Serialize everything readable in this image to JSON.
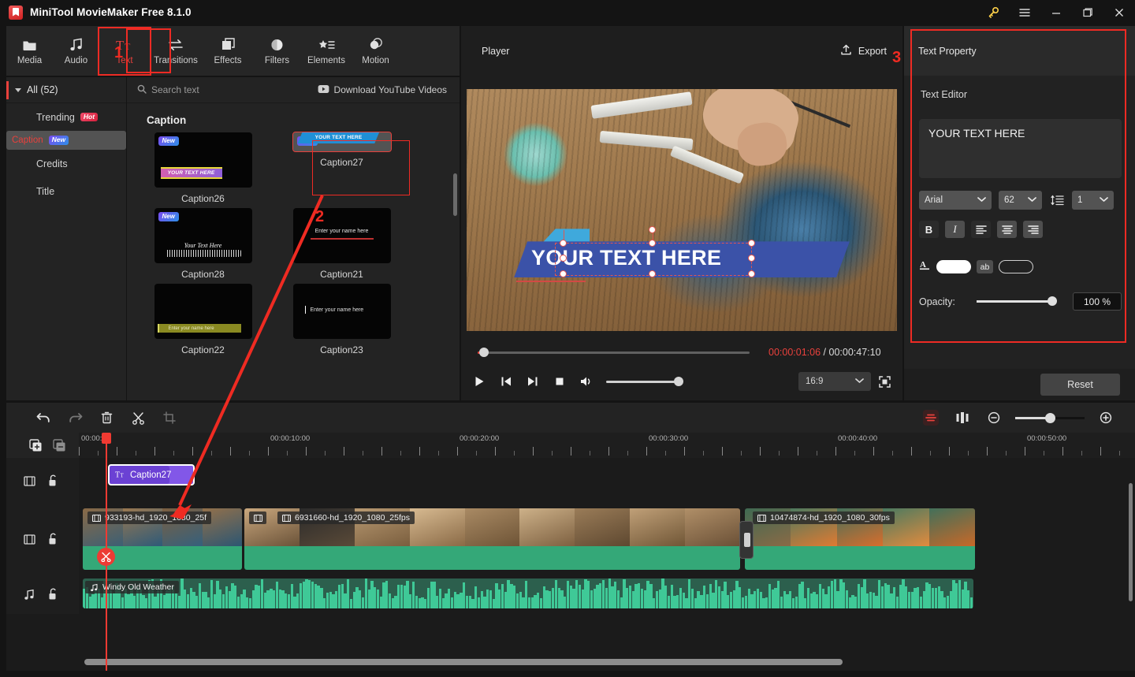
{
  "window": {
    "title": "MiniTool MovieMaker Free 8.1.0",
    "controls": [
      "key-icon",
      "menu-icon",
      "minimize-icon",
      "maximize-icon",
      "close-icon"
    ]
  },
  "toolbar": {
    "tabs": [
      {
        "label": "Media",
        "icon": "folder-icon",
        "active": false
      },
      {
        "label": "Audio",
        "icon": "music-note-icon",
        "active": false
      },
      {
        "label": "Text",
        "icon": "text-tt-icon",
        "active": true
      },
      {
        "label": "Transitions",
        "icon": "transitions-arrows-icon",
        "active": false
      },
      {
        "label": "Effects",
        "icon": "effects-layers-icon",
        "active": false
      },
      {
        "label": "Filters",
        "icon": "filters-droplet-icon",
        "active": false
      },
      {
        "label": "Elements",
        "icon": "elements-star-list-icon",
        "active": false
      },
      {
        "label": "Motion",
        "icon": "motion-circles-icon",
        "active": false
      }
    ]
  },
  "sidebar": {
    "all_label": "All (52)",
    "items": [
      {
        "label": "Trending",
        "badge": "Hot",
        "badge_kind": "hot",
        "selected": false
      },
      {
        "label": "Caption",
        "badge": "New",
        "badge_kind": "new",
        "selected": true
      },
      {
        "label": "Credits",
        "badge": "",
        "badge_kind": "",
        "selected": false
      },
      {
        "label": "Title",
        "badge": "",
        "badge_kind": "",
        "selected": false
      }
    ]
  },
  "library": {
    "search_placeholder": "Search text",
    "download_label": "Download YouTube Videos",
    "section_title": "Caption",
    "items": [
      {
        "name": "Caption26",
        "badge": "New",
        "selected": false,
        "preview": "magenta-bar"
      },
      {
        "name": "Caption27",
        "badge": "New",
        "selected": true,
        "preview": "blue-banner"
      },
      {
        "name": "Caption28",
        "badge": "New",
        "selected": false,
        "preview": "script-squiggle",
        "preview_text": "Your Text Here"
      },
      {
        "name": "Caption21",
        "badge": "",
        "selected": false,
        "preview": "red-underline",
        "preview_text": "Enter your name here"
      },
      {
        "name": "Caption22",
        "badge": "",
        "selected": false,
        "preview": "olive-bar",
        "preview_text": "Enter your name here"
      },
      {
        "name": "Caption23",
        "badge": "",
        "selected": false,
        "preview": "plain-caret",
        "preview_text": "Enter your name here"
      }
    ]
  },
  "player": {
    "title": "Player",
    "export_label": "Export",
    "overlay_text": "YOUR TEXT HERE",
    "current_time": "00:00:01:06",
    "separator": "/",
    "total_time": "00:00:47:10",
    "aspect_ratio": "16:9",
    "controls": [
      "play-icon",
      "previous-frame-icon",
      "next-frame-icon",
      "stop-icon",
      "volume-icon",
      "fullscreen-icon"
    ]
  },
  "text_property": {
    "panel_title": "Text Property",
    "editor_label": "Text Editor",
    "editor_value": "YOUR TEXT HERE",
    "font_family": "Arial",
    "font_size": "62",
    "line_spacing": "1",
    "style_buttons": [
      {
        "name": "bold",
        "glyph": "B",
        "active": true
      },
      {
        "name": "italic",
        "glyph": "I",
        "active": false
      },
      {
        "name": "align-left",
        "glyph": "",
        "active": true
      },
      {
        "name": "align-center",
        "glyph": "",
        "active": false
      },
      {
        "name": "align-right",
        "glyph": "",
        "active": false
      }
    ],
    "text_color": "#ffffff",
    "outline_color": "transparent",
    "opacity_label": "Opacity:",
    "opacity_value": "100 %",
    "opacity_percent": 100,
    "reset_label": "Reset"
  },
  "timeline": {
    "tools": [
      "undo-icon",
      "redo-icon",
      "delete-icon",
      "split-icon",
      "crop-icon"
    ],
    "right_tools": [
      "speed-ramp-icon",
      "keyframe-icon",
      "zoom-out-icon",
      "zoom-in-icon"
    ],
    "zoom_percent": 45,
    "ruler_labels": [
      "00:00:00",
      "00:00:10:00",
      "00:00:20:00",
      "00:00:30:00",
      "00:00:40:00",
      "00:00:50:00"
    ],
    "header_buttons": [
      "add-track-icon",
      "remove-track-icon"
    ],
    "tracks": [
      {
        "kind": "text",
        "icon": "film-strip-icon",
        "lock_icon": "unlock-icon",
        "clips": [
          {
            "label": "Caption27",
            "icon": "text-tt-icon",
            "selected": true
          }
        ]
      },
      {
        "kind": "video",
        "icon": "film-strip-icon",
        "lock_icon": "unlock-icon",
        "clips": [
          {
            "label": "933193-hd_1920_1080_25f",
            "icon": "film-icon"
          },
          {
            "label": "6931660-hd_1920_1080_25fps",
            "icon": "film-icon"
          },
          {
            "label": "10474874-hd_1920_1080_30fps",
            "icon": "film-icon"
          }
        ]
      },
      {
        "kind": "audio",
        "icon": "music-note-icon",
        "lock_icon": "unlock-icon",
        "clips": [
          {
            "label": "Windy Old Weather",
            "icon": "music-note-icon"
          }
        ]
      }
    ]
  },
  "annotations": [
    {
      "label": "1",
      "target": "text-tab"
    },
    {
      "label": "2",
      "target": "caption27-thumbnail"
    },
    {
      "label": "3",
      "target": "text-property-panel"
    }
  ],
  "colors": {
    "accent_red": "#e8413c",
    "anno_red": "#ee2b24",
    "clip_purple": "#8257e8",
    "audio_green": "#3fc997",
    "video_green": "#34a878"
  }
}
